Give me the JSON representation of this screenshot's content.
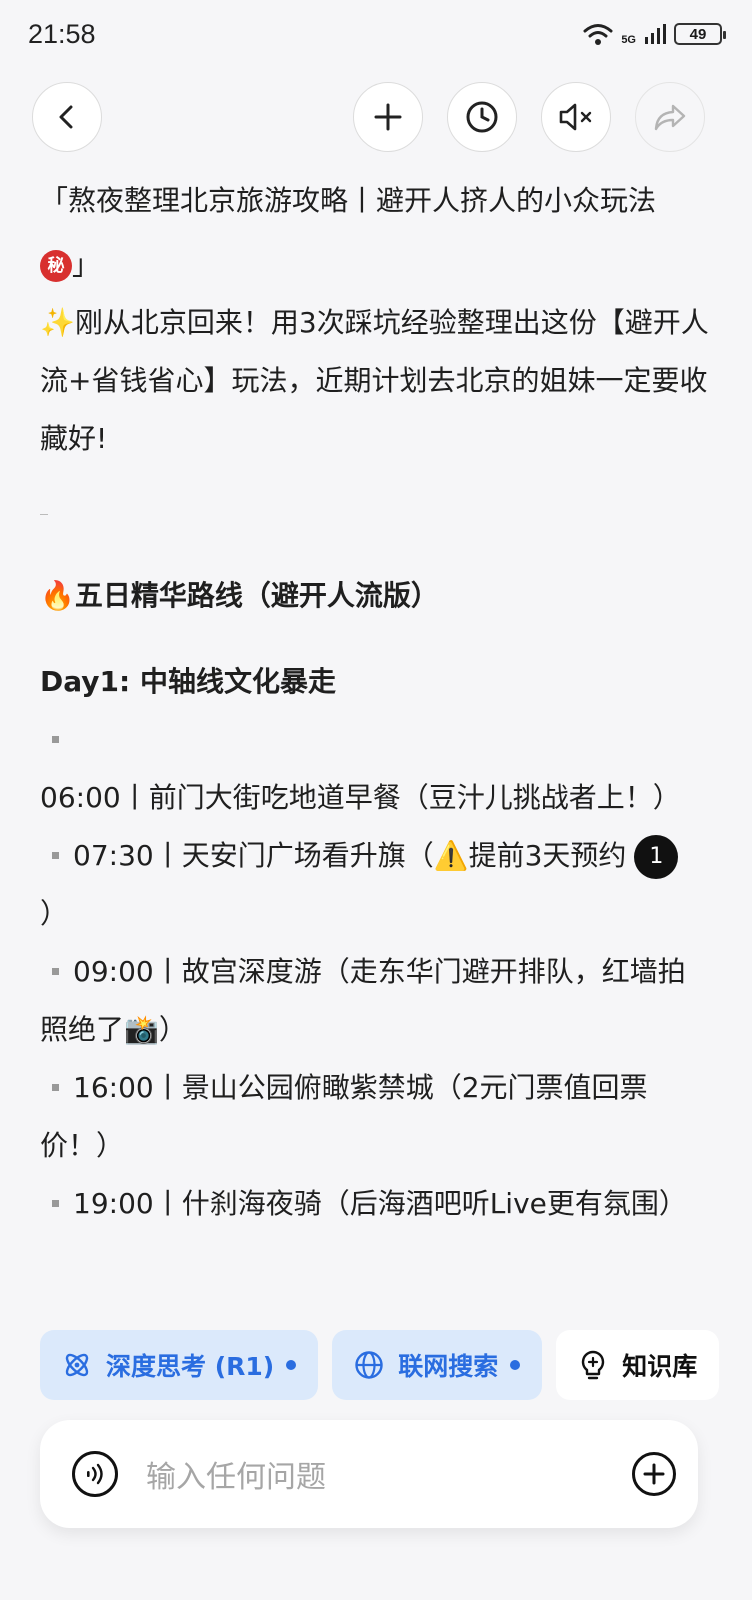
{
  "status_bar": {
    "time": "21:58",
    "network": "5G",
    "battery": "49"
  },
  "nav": {
    "back_icon": "chevron-left-icon",
    "add_icon": "plus-icon",
    "history_icon": "clock-icon",
    "mute_icon": "speaker-mute-icon",
    "share_icon": "share-arrow-icon"
  },
  "message": {
    "title_line1": "「熬夜整理北京旅游攻略丨避开人挤人的小众玩法",
    "title_badge": "秘",
    "title_line2_suffix": "」",
    "intro_emoji": "✨",
    "intro": "刚从北京回来！用3次踩坑经验整理出这份【避开人流+省钱省心】玩法，近期计划去北京的姐妹一定要收藏好!",
    "section_emoji": "🔥",
    "section_title": "五日精华路线（避开人流版）",
    "day1_title": "Day1: 中轴线文化暴走",
    "item1": "06:00丨前门大街吃地道早餐（豆汁儿挑战者上！）",
    "item2_a": "07:30丨天安门广场看升旗（",
    "item2_warn": "⚠️",
    "item2_b": "提前3天预约",
    "item2_badge": "1",
    "item2_c": "）",
    "item3_a": "09:00丨故宫深度游（走东华门避开排队，红墙拍照绝了",
    "item3_emoji": "📸",
    "item3_b": "）",
    "item4": "16:00丨景山公园俯瞰紫禁城（2元门票值回票价！）",
    "item5": "19:00丨什刹海夜骑（后海酒吧听Live更有氛围）"
  },
  "chips": {
    "deep_think": "深度思考 (R1)",
    "web_search": "联网搜索",
    "knowledge": "知识库"
  },
  "input": {
    "placeholder": "输入任何问题"
  },
  "colors": {
    "accent": "#2a6de0",
    "chip_bg": "#dbe9fb",
    "badge_red": "#d8302f"
  }
}
